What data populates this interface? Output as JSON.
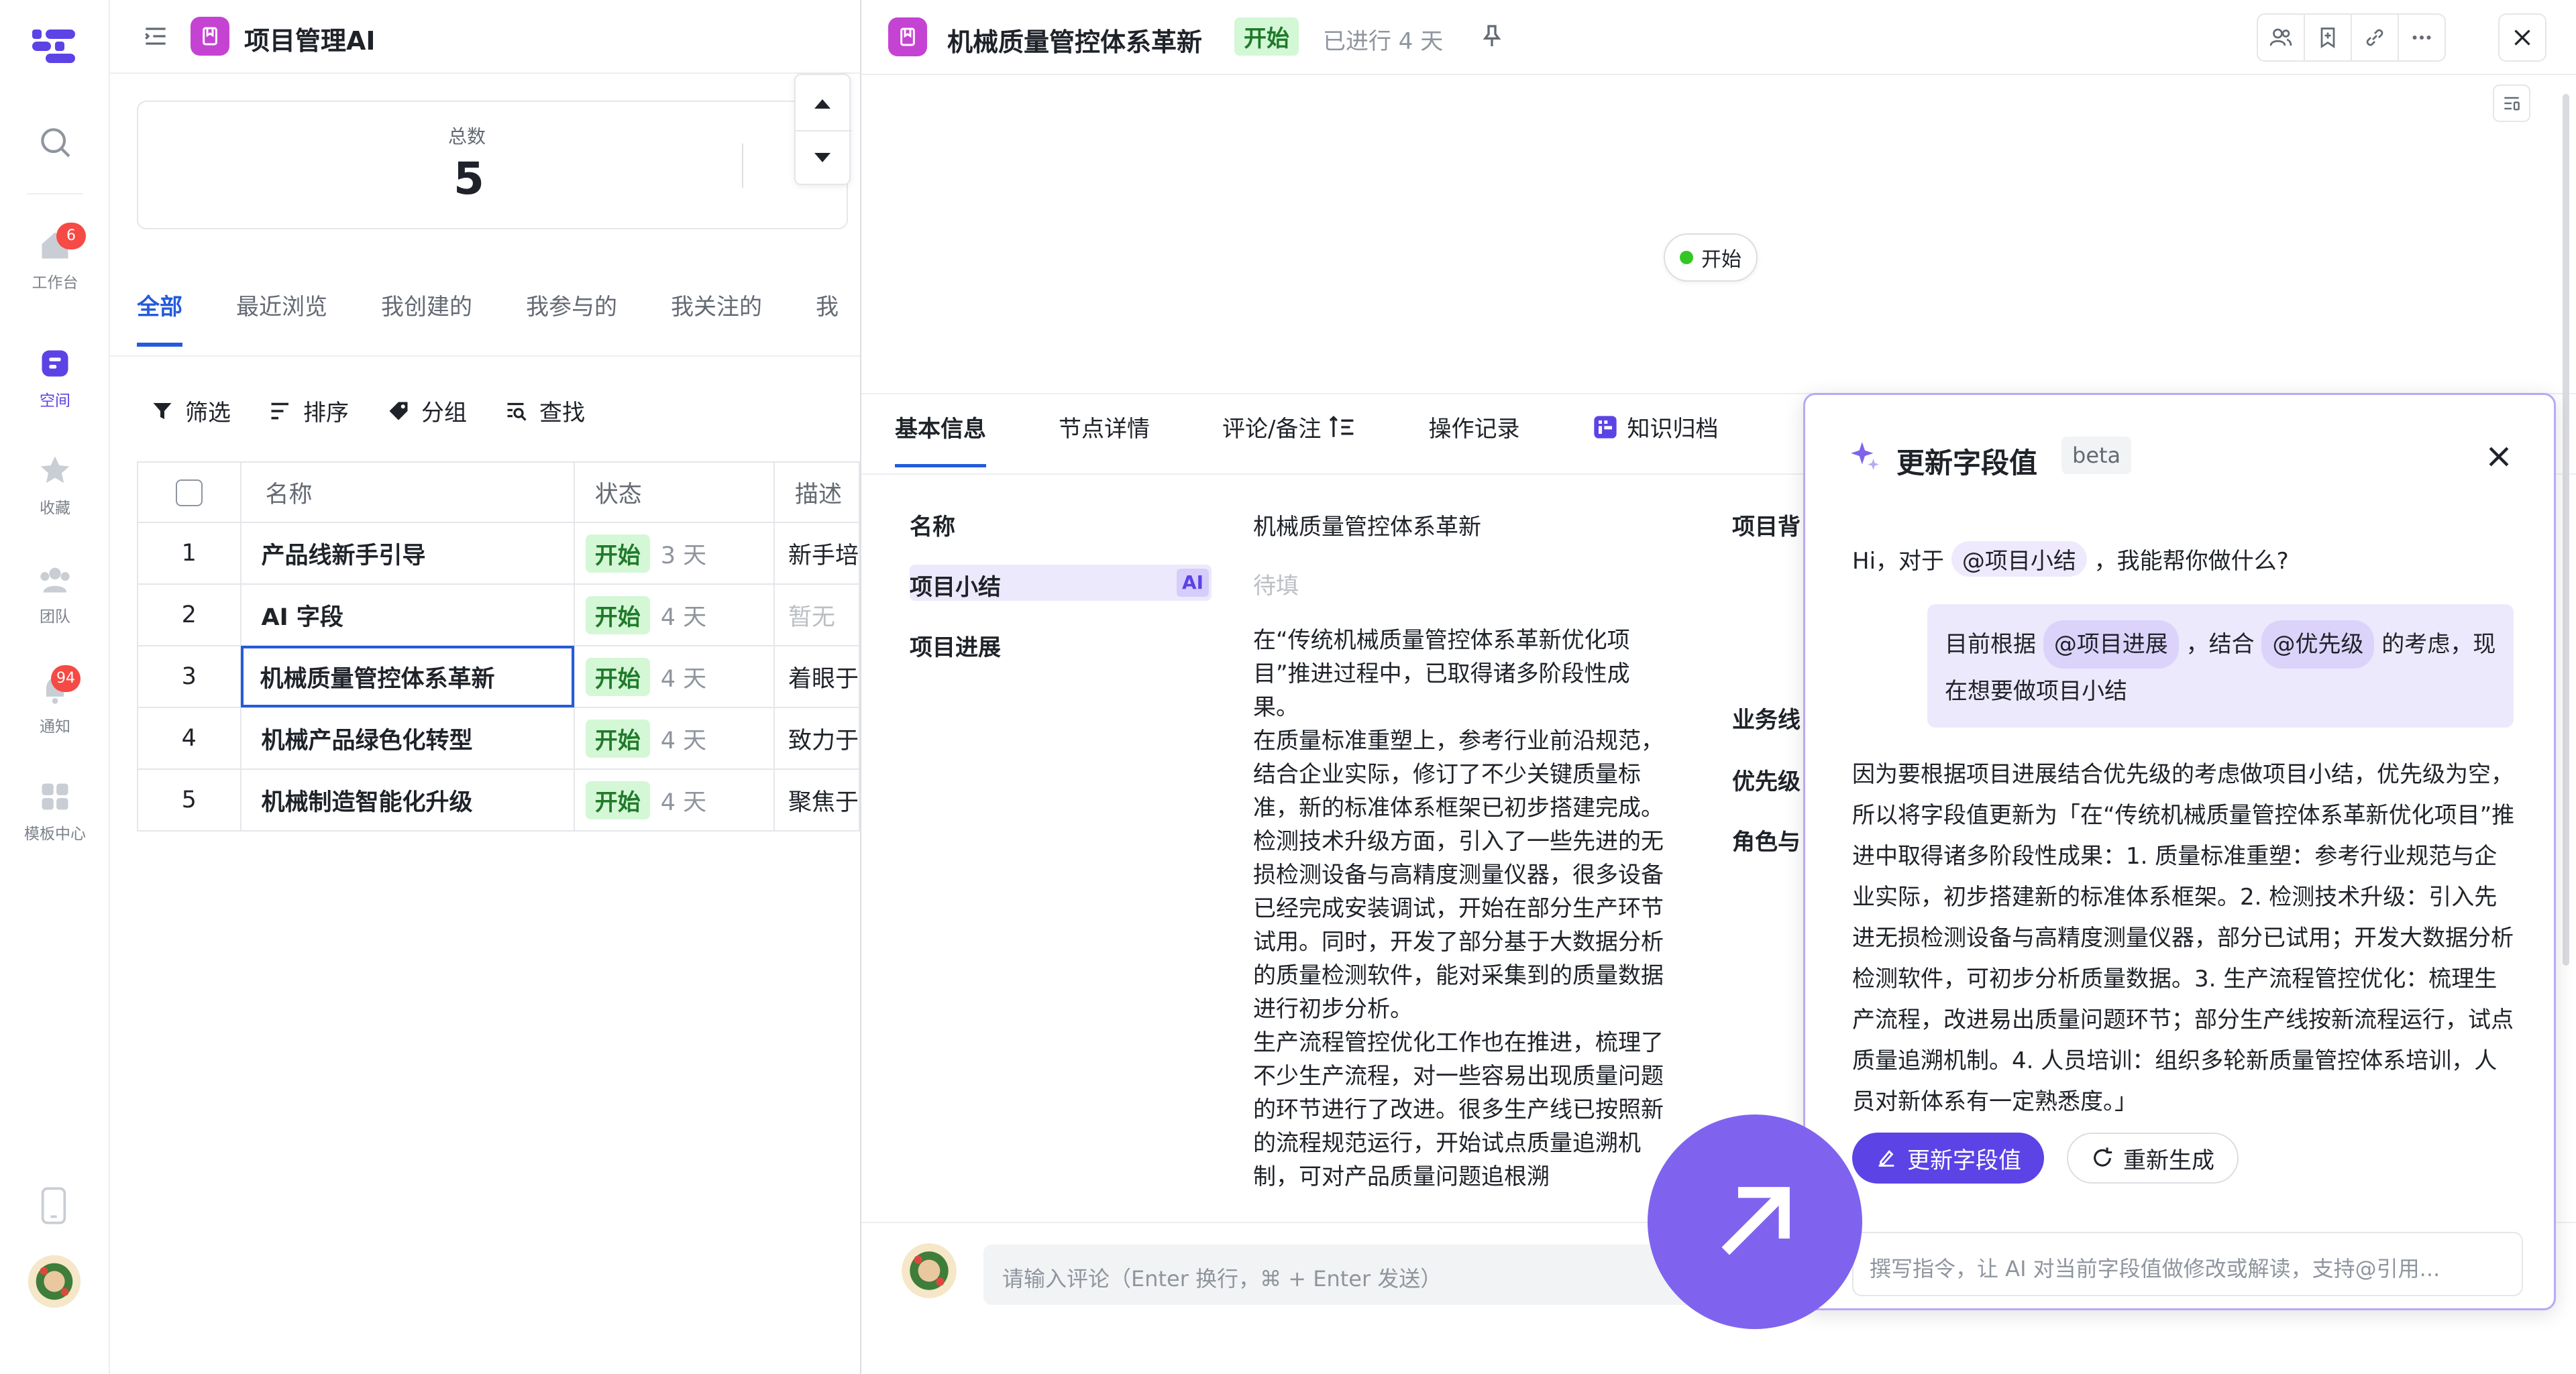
{
  "rail": {
    "items": [
      {
        "label": "工作台",
        "icon": "home-icon",
        "badge": "6"
      },
      {
        "label": "空间",
        "icon": "space-icon",
        "active": true
      },
      {
        "label": "收藏",
        "icon": "star-icon"
      },
      {
        "label": "团队",
        "icon": "team-icon"
      },
      {
        "label": "通知",
        "icon": "bell-icon",
        "badge": "94"
      },
      {
        "label": "模板中心",
        "icon": "template-icon"
      }
    ]
  },
  "list": {
    "app_title": "项目管理AI",
    "summary_label": "总数",
    "summary_value": "5",
    "tabs": [
      "全部",
      "最近浏览",
      "我创建的",
      "我参与的",
      "我关注的",
      "我"
    ],
    "toolbar": {
      "filter": "筛选",
      "sort": "排序",
      "group": "分组",
      "find": "查找"
    },
    "columns": [
      "名称",
      "状态",
      "描述"
    ],
    "rows": [
      {
        "idx": "1",
        "name": "产品线新手引导",
        "status": "开始",
        "days": "3 天",
        "desc": "新手培"
      },
      {
        "idx": "2",
        "name": "AI 字段",
        "status": "开始",
        "days": "4 天",
        "desc": "暂无"
      },
      {
        "idx": "3",
        "name": "机械质量管控体系革新",
        "status": "开始",
        "days": "4 天",
        "desc": "着眼于"
      },
      {
        "idx": "4",
        "name": "机械产品绿色化转型",
        "status": "开始",
        "days": "4 天",
        "desc": "致力于"
      },
      {
        "idx": "5",
        "name": "机械制造智能化升级",
        "status": "开始",
        "days": "4 天",
        "desc": "聚焦于"
      }
    ]
  },
  "detail": {
    "title": "机械质量管控体系革新",
    "status": "开始",
    "elapsed": "已进行 4 天",
    "flow_node": "开始",
    "tabs": [
      "基本信息",
      "节点详情",
      "评论/备注",
      "操作记录",
      "知识归档"
    ],
    "fields": {
      "name_label": "名称",
      "name_value": "机械质量管控体系革新",
      "summary_label": "项目小结",
      "summary_ai": "AI",
      "summary_placeholder": "待填",
      "progress_label": "项目进展",
      "right_labels": [
        "项目背",
        "业务线",
        "优先级",
        "角色与"
      ]
    },
    "progress_paragraphs": [
      "在“传统机械质量管控体系革新优化项目”推进过程中，已取得诸多阶段性成果。",
      "在质量标准重塑上，参考行业前沿规范，结合企业实际，修订了不少关键质量标准，新的标准体系框架已初步搭建完成。",
      "检测技术升级方面，引入了一些先进的无损检测设备与高精度测量仪器，很多设备已经完成安装调试，开始在部分生产环节试用。同时，开发了部分基于大数据分析的质量检测软件，能对采集到的质量数据进行初步分析。",
      "生产流程管控优化工作也在推进，梳理了不少生产流程，对一些容易出现质量问题的环节进行了改进。很多生产线已按照新的流程规范运行，开始试点质量追溯机制，可对产品质量问题追根溯"
    ],
    "comment_placeholder": "请输入评论（Enter 换行，⌘ + Enter 发送）"
  },
  "ai_panel": {
    "title": "更新字段值",
    "beta": "beta",
    "greeting_pre": "Hi，对于",
    "greeting_mention": "@项目小结",
    "greeting_post": "，我能帮你做什么?",
    "user_pre": "目前根据",
    "user_mention1": "@项目进展",
    "user_mid": "，结合",
    "user_mention2": "@优先级",
    "user_post": "的考虑，现在想要做项目小结",
    "answer": "因为要根据项目进展结合优先级的考虑做项目小结，优先级为空，所以将字段值更新为「在“传统机械质量管控体系革新优化项目”推进中取得诸多阶段性成果：1. 质量标准重塑：参考行业规范与企业实际，初步搭建新的标准体系框架。2. 检测技术升级：引入先进无损检测设备与高精度测量仪器，部分已试用；开发大数据分析检测软件，可初步分析质量数据。3. 生产流程管控优化：梳理生产流程，改进易出质量问题环节；部分生产线按新流程运行，试点质量追溯机制。4. 人员培训：组织多轮新质量管控体系培训，人员对新体系有一定熟悉度。」",
    "update_button": "更新字段值",
    "regenerate_button": "重新生成",
    "input_placeholder": "撰写指令，让 AI 对当前字段值做修改或解读，支持@引用..."
  },
  "colors": {
    "accent": "#245bdb",
    "ai_purple": "#5b43e6",
    "status_green": "#d4f7d6"
  }
}
